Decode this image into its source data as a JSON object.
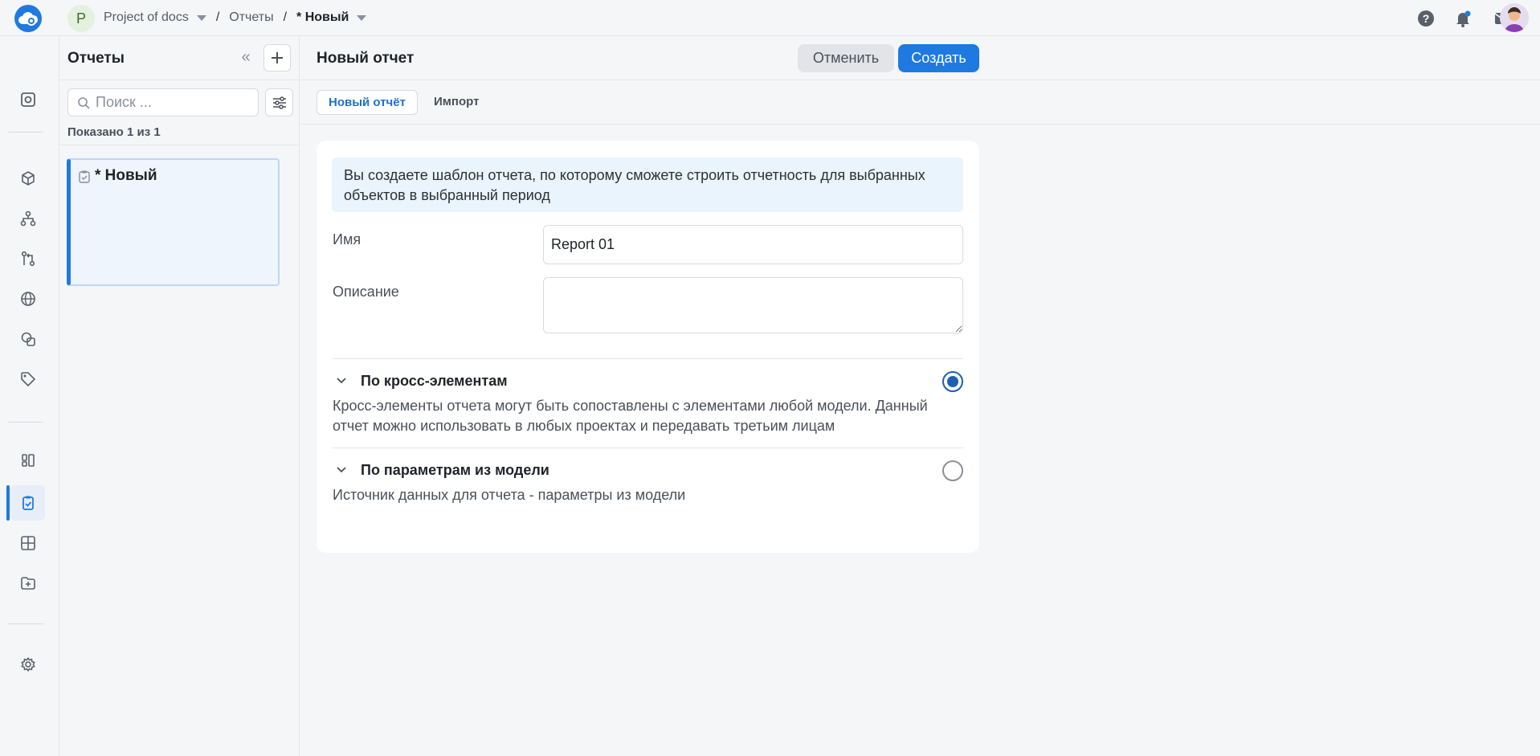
{
  "topbar": {
    "project_initial": "P",
    "project_name": "Project of docs",
    "section": "Отчеты",
    "current": "* Новый"
  },
  "panel": {
    "title": "Отчеты",
    "search_placeholder": "Поиск ...",
    "shown_count": "Показано 1 из 1",
    "items": [
      {
        "title": "* Новый"
      }
    ]
  },
  "main": {
    "title": "Новый отчет",
    "cancel_label": "Отменить",
    "create_label": "Создать",
    "tabs": [
      {
        "label": "Новый отчёт"
      },
      {
        "label": "Импорт"
      }
    ],
    "info": "Вы создаете шаблон отчета, по которому сможете строить отчетность для выбранных объектов в выбранный период",
    "name_label": "Имя",
    "name_value": "Report 01",
    "description_label": "Описание",
    "description_value": "",
    "options": [
      {
        "title": "По кросс-элементам",
        "description": "Кросс-элементы отчета могут быть сопоставлены с элементами любой модели. Данный отчет можно использовать в любых проектах и передавать третьим лицам",
        "selected": true
      },
      {
        "title": "По параметрам из модели",
        "description": "Источник данных для отчета - параметры из модели",
        "selected": false
      }
    ]
  },
  "colors": {
    "accent": "#1e7ae0",
    "info_bg": "#eaf4fd",
    "radio_checked": "#1e5fb0"
  }
}
